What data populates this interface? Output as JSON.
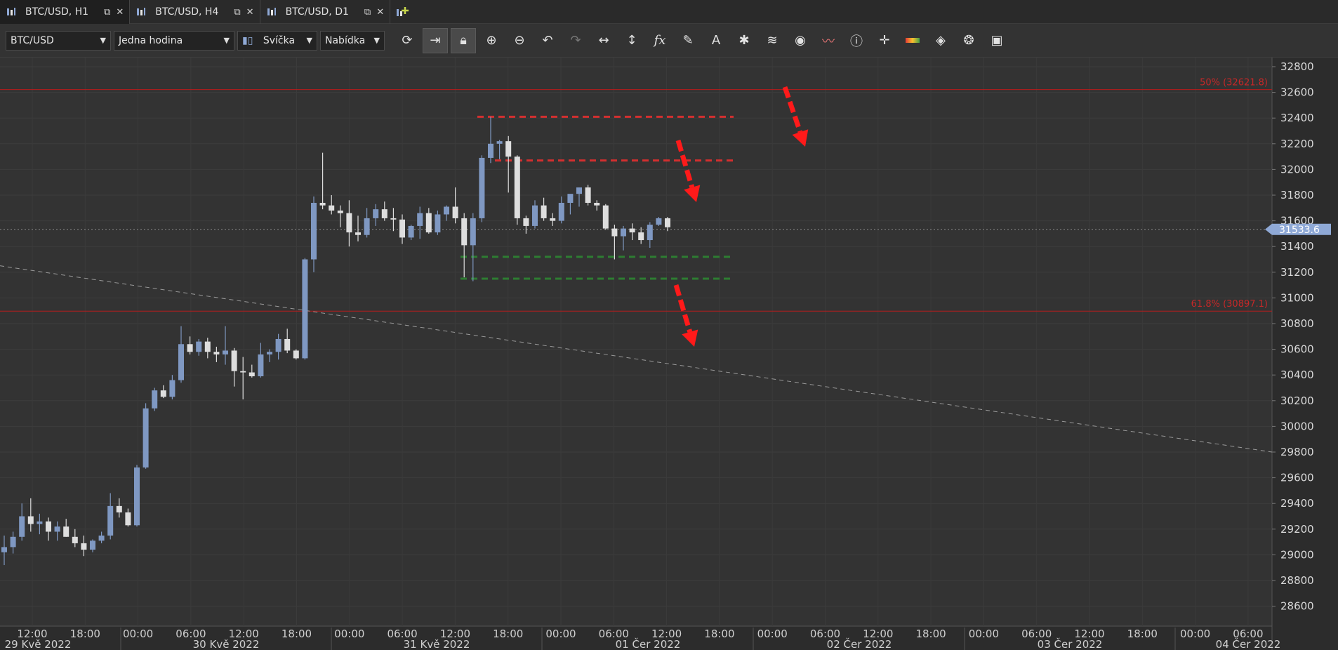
{
  "tabs": [
    {
      "label": "BTC/USD, H1",
      "active": true
    },
    {
      "label": "BTC/USD, H4",
      "active": false
    },
    {
      "label": "BTC/USD, D1",
      "active": false
    }
  ],
  "toolbar": {
    "symbol": "BTC/USD",
    "timeframe": "Jedna hodina",
    "chart_type": "Svíčka",
    "price_side": "Nabídka",
    "icons": [
      "refresh-icon",
      "autoscroll-icon",
      "lock-icon",
      "zoom-in-icon",
      "zoom-out-icon",
      "undo-icon",
      "redo-icon",
      "horizontal-resize-icon",
      "vertical-resize-icon",
      "function-icon",
      "pencil-icon",
      "text-icon",
      "pattern-icon",
      "layers-icon",
      "eye-icon",
      "signals-icon",
      "info-icon",
      "crosshair-icon",
      "ruler-icon",
      "fill-icon",
      "cycle-icon",
      "save-icon"
    ]
  },
  "chart": {
    "current_price": "31533.6",
    "fib_50_label": "50% (32621.8)",
    "fib_618_label": "61.8% (30897.1)",
    "colors": {
      "bull": "#7f98c2",
      "bear": "#dedede",
      "fib": "#b71c1c",
      "resistance": "#d32f2f",
      "support": "#2e7d32",
      "arrow": "#ff1a1a",
      "price_badge": "#8fa9d6"
    }
  },
  "chart_data": {
    "type": "candlestick",
    "ylim": [
      28500,
      32900
    ],
    "y_ticks": [
      "32800",
      "32600",
      "32400",
      "32200",
      "32000",
      "31800",
      "31600",
      "31400",
      "31200",
      "31000",
      "30800",
      "30600",
      "30400",
      "30200",
      "30000",
      "29800",
      "29600",
      "29400",
      "29200",
      "29000",
      "28800",
      "28600"
    ],
    "x_time_ticks": [
      "12:00",
      "18:00",
      "00:00",
      "06:00",
      "12:00",
      "18:00",
      "00:00",
      "06:00",
      "12:00",
      "18:00",
      "00:00",
      "06:00",
      "12:00",
      "18:00",
      "00:00",
      "06:00",
      "12:00",
      "18:00",
      "00:00",
      "06:00",
      "12:00",
      "18:00",
      "00:00",
      "06:00"
    ],
    "x_date_labels": [
      "29 Kvě 2022",
      "30 Kvě 2022",
      "31 Kvě 2022",
      "01 Čer 2022",
      "02 Čer 2022",
      "03 Čer 2022",
      "04 Čer 2022"
    ],
    "candles": [
      [
        29020,
        29150,
        28920,
        29060
      ],
      [
        29060,
        29180,
        29010,
        29140
      ],
      [
        29140,
        29400,
        29110,
        29300
      ],
      [
        29300,
        29440,
        29180,
        29240
      ],
      [
        29240,
        29320,
        29160,
        29260
      ],
      [
        29260,
        29290,
        29110,
        29180
      ],
      [
        29180,
        29260,
        29110,
        29220
      ],
      [
        29220,
        29280,
        29140,
        29140
      ],
      [
        29140,
        29200,
        29060,
        29090
      ],
      [
        29090,
        29150,
        28990,
        29040
      ],
      [
        29040,
        29120,
        29020,
        29110
      ],
      [
        29110,
        29180,
        29090,
        29150
      ],
      [
        29150,
        29480,
        29120,
        29380
      ],
      [
        29380,
        29440,
        29290,
        29330
      ],
      [
        29330,
        29360,
        29220,
        29230
      ],
      [
        29230,
        29700,
        29220,
        29680
      ],
      [
        29680,
        30180,
        29670,
        30140
      ],
      [
        30140,
        30300,
        30120,
        30280
      ],
      [
        30280,
        30320,
        30220,
        30230
      ],
      [
        30230,
        30400,
        30210,
        30360
      ],
      [
        30360,
        30780,
        30340,
        30640
      ],
      [
        30640,
        30700,
        30560,
        30580
      ],
      [
        30580,
        30680,
        30550,
        30660
      ],
      [
        30660,
        30690,
        30530,
        30580
      ],
      [
        30580,
        30620,
        30500,
        30560
      ],
      [
        30560,
        30780,
        30480,
        30590
      ],
      [
        30590,
        30610,
        30310,
        30430
      ],
      [
        30430,
        30540,
        30210,
        30420
      ],
      [
        30420,
        30480,
        30380,
        30390
      ],
      [
        30390,
        30650,
        30380,
        30560
      ],
      [
        30560,
        30600,
        30500,
        30580
      ],
      [
        30580,
        30720,
        30520,
        30680
      ],
      [
        30680,
        30760,
        30570,
        30590
      ],
      [
        30590,
        30600,
        30520,
        30530
      ],
      [
        30530,
        31310,
        30520,
        31300
      ],
      [
        31300,
        31790,
        31200,
        31740
      ],
      [
        31740,
        32130,
        31690,
        31720
      ],
      [
        31720,
        31800,
        31650,
        31680
      ],
      [
        31680,
        31720,
        31550,
        31660
      ],
      [
        31660,
        31760,
        31400,
        31510
      ],
      [
        31510,
        31640,
        31440,
        31490
      ],
      [
        31490,
        31700,
        31470,
        31620
      ],
      [
        31620,
        31730,
        31560,
        31690
      ],
      [
        31690,
        31750,
        31600,
        31620
      ],
      [
        31620,
        31700,
        31520,
        31610
      ],
      [
        31610,
        31650,
        31420,
        31470
      ],
      [
        31470,
        31570,
        31450,
        31560
      ],
      [
        31560,
        31710,
        31460,
        31660
      ],
      [
        31660,
        31700,
        31500,
        31510
      ],
      [
        31510,
        31680,
        31490,
        31650
      ],
      [
        31650,
        31720,
        31600,
        31710
      ],
      [
        31710,
        31860,
        31580,
        31620
      ],
      [
        31620,
        31660,
        31160,
        31410
      ],
      [
        31410,
        31660,
        31130,
        31620
      ],
      [
        31620,
        32110,
        31590,
        32090
      ],
      [
        32090,
        32410,
        32050,
        32200
      ],
      [
        32200,
        32230,
        32080,
        32220
      ],
      [
        32220,
        32260,
        31820,
        32100
      ],
      [
        32100,
        32110,
        31570,
        31620
      ],
      [
        31620,
        31640,
        31500,
        31560
      ],
      [
        31560,
        31760,
        31540,
        31720
      ],
      [
        31720,
        31780,
        31600,
        31620
      ],
      [
        31620,
        31660,
        31560,
        31600
      ],
      [
        31600,
        31790,
        31580,
        31740
      ],
      [
        31740,
        31800,
        31650,
        31810
      ],
      [
        31810,
        31860,
        31710,
        31860
      ],
      [
        31860,
        31880,
        31720,
        31740
      ],
      [
        31740,
        31760,
        31680,
        31720
      ],
      [
        31720,
        31730,
        31530,
        31540
      ],
      [
        31540,
        31570,
        31300,
        31480
      ],
      [
        31480,
        31560,
        31370,
        31540
      ],
      [
        31540,
        31580,
        31450,
        31510
      ],
      [
        31510,
        31550,
        31420,
        31450
      ],
      [
        31450,
        31590,
        31390,
        31570
      ],
      [
        31570,
        31630,
        31560,
        31620
      ],
      [
        31620,
        31630,
        31520,
        31550
      ]
    ],
    "fib_levels": [
      32621.8,
      30897.1
    ],
    "current_price": 31533.6
  }
}
